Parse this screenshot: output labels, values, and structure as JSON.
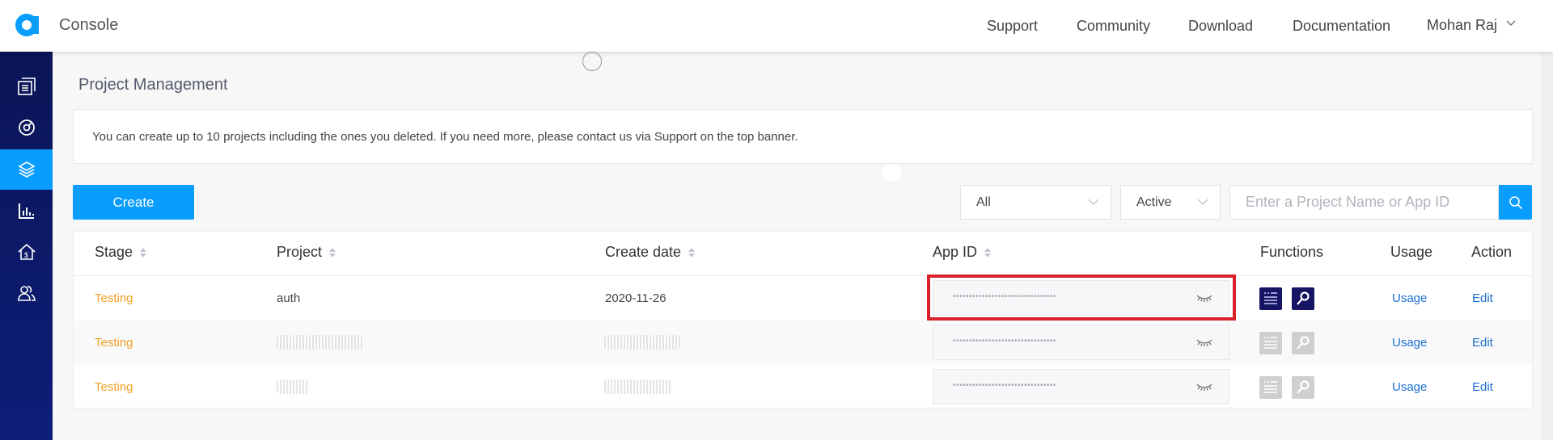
{
  "header": {
    "brand": "Console",
    "nav": [
      "Support",
      "Community",
      "Download",
      "Documentation"
    ],
    "user": "Mohan Raj",
    "accent": "#099dfd"
  },
  "sidebar": {
    "items": [
      {
        "icon": "projects-list-icon",
        "active": false
      },
      {
        "icon": "dashboard-gauge-icon",
        "active": false
      },
      {
        "icon": "layers-icon",
        "active": true
      },
      {
        "icon": "analytics-chart-icon",
        "active": false
      },
      {
        "icon": "billing-house-icon",
        "active": false
      },
      {
        "icon": "members-icon",
        "active": false
      }
    ]
  },
  "main": {
    "title": "Project Management",
    "notice": "You can create up to 10 projects including the ones you deleted. If you need more, please contact us via Support on the top banner.",
    "create_label": "Create",
    "filters": {
      "stage_selected": "All",
      "status_selected": "Active",
      "search_placeholder": "Enter a Project Name or App ID"
    },
    "table": {
      "columns": [
        "Stage",
        "Project",
        "Create date",
        "App ID",
        "Functions",
        "Usage",
        "Action"
      ],
      "rows": [
        {
          "stage": "Testing",
          "project": "auth",
          "create_date": "2020-11-26",
          "app_id": "••••••••••••••••••••••••••••••••",
          "functions_enabled": true,
          "usage": "Usage",
          "action": "Edit",
          "highlighted": true
        },
        {
          "stage": "Testing",
          "project": "[redacted]",
          "create_date": "[redacted]",
          "app_id": "••••••••••••••••••••••••••••••••",
          "functions_enabled": false,
          "usage": "Usage",
          "action": "Edit",
          "highlighted": false
        },
        {
          "stage": "Testing",
          "project": "[redacted]",
          "create_date": "[redacted]",
          "app_id": "••••••••••••••••••••••••••••••••",
          "functions_enabled": false,
          "usage": "Usage",
          "action": "Edit",
          "highlighted": false
        }
      ]
    }
  }
}
